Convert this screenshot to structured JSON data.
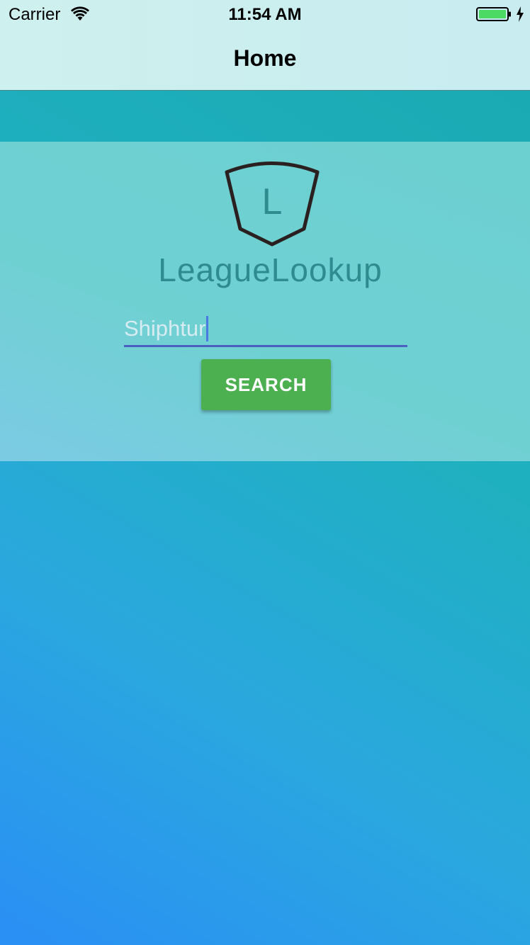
{
  "status_bar": {
    "carrier": "Carrier",
    "time": "11:54 AM",
    "icons": [
      "wifi-icon",
      "battery-icon",
      "charging-icon"
    ]
  },
  "nav": {
    "title": "Home"
  },
  "logo": {
    "letter": "L",
    "text": "LeagueLookup"
  },
  "search": {
    "value": "Shiphtur",
    "button_label": "SEARCH"
  },
  "colors": {
    "button": "#4caf50",
    "underline": "#4b5fc0",
    "logo_text": "#2e8b8e",
    "battery": "#4cd964"
  }
}
